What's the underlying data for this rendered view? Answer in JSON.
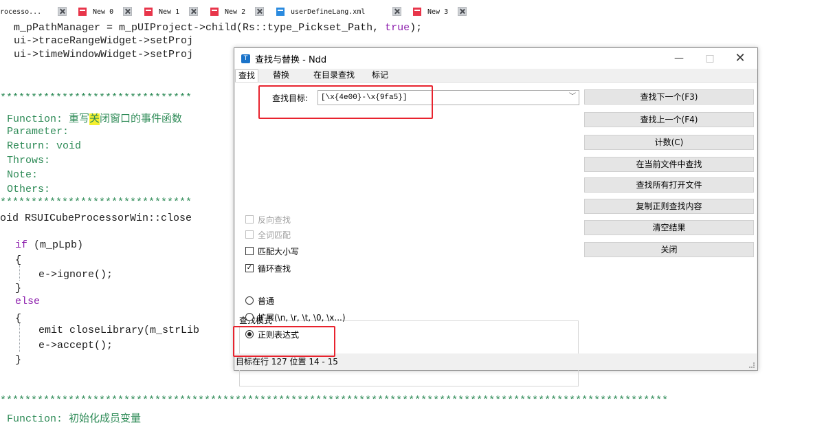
{
  "tabs": [
    {
      "label": "rocesso...",
      "icon": "none"
    },
    {
      "label": "New 0",
      "icon": "red-file-icon"
    },
    {
      "label": "New 1",
      "icon": "red-file-icon"
    },
    {
      "label": "New 2",
      "icon": "red-file-icon"
    },
    {
      "label": "userDefineLang.xml",
      "icon": "blue-file-icon"
    },
    {
      "label": "New 3",
      "icon": "red-file-icon"
    }
  ],
  "code": {
    "line1": "m_pPathManager = m_pUIProject->child(Rs::type_Pickset_Path, ",
    "line1_kw": "true",
    "line1_end": ");",
    "line2": "ui->traceRangeWidget->setProj",
    "line3": "ui->timeWindowWidget->setProj",
    "stars": "*******************************",
    "func_prefix": "Function: 重写",
    "func_highlight": "关",
    "func_suffix": "闭窗口的事件函数",
    "param": "Parameter:",
    "ret": "Return: void",
    "throws": "Throws:",
    "note": "Note:",
    "others": "Others:",
    "void_line": "oid RSUICubeProcessorWin::close",
    "if_kw": "if",
    "if_rest": " (m_pLpb)",
    "brace_open": "{",
    "ignore": "e->ignore();",
    "brace_close": "}",
    "else_kw": "else",
    "emit": "emit closeLibrary(m_strLib",
    "accept": "e->accept();",
    "stars_long": "************************************************************************************************************",
    "func2": "Function: 初始化成员变量"
  },
  "dialog": {
    "title": "查找与替换 - Ndd",
    "app_icon": "T",
    "window_buttons": {
      "minimize": "—",
      "maximize": "□",
      "close": "✕"
    },
    "tabs": [
      "查找",
      "替换",
      "在目录查找",
      "标记"
    ],
    "find_label": "查找目标:",
    "find_value": "[\\x{4e00}-\\x{9fa5}]",
    "combo_arrow": "﹀",
    "buttons": [
      "查找下一个(F3)",
      "查找上一个(F4)",
      "计数(C)",
      "在当前文件中查找",
      "查找所有打开文件",
      "复制正则查找内容",
      "清空结果",
      "关闭"
    ],
    "options": [
      {
        "label": "反向查找",
        "checked": false,
        "disabled": true
      },
      {
        "label": "全词匹配",
        "checked": false,
        "disabled": true
      },
      {
        "label": "匹配大小写",
        "checked": false,
        "disabled": false
      },
      {
        "label": "循环查找",
        "checked": true,
        "disabled": false
      }
    ],
    "check_mark": "✓",
    "mode_title": "查找模式",
    "modes": [
      {
        "label": "普通",
        "selected": false
      },
      {
        "label": "扩展(\\n, \\r, \\t, \\0, \\x...)",
        "selected": false
      },
      {
        "label": "正则表达式",
        "selected": true
      }
    ],
    "status": "目标在行 127 位置 14 - 15"
  },
  "colors": {
    "annotation": "#e8232e",
    "comment": "#2e8b57",
    "keyword": "#8c1dac",
    "highlight": "#f5ef2f"
  }
}
